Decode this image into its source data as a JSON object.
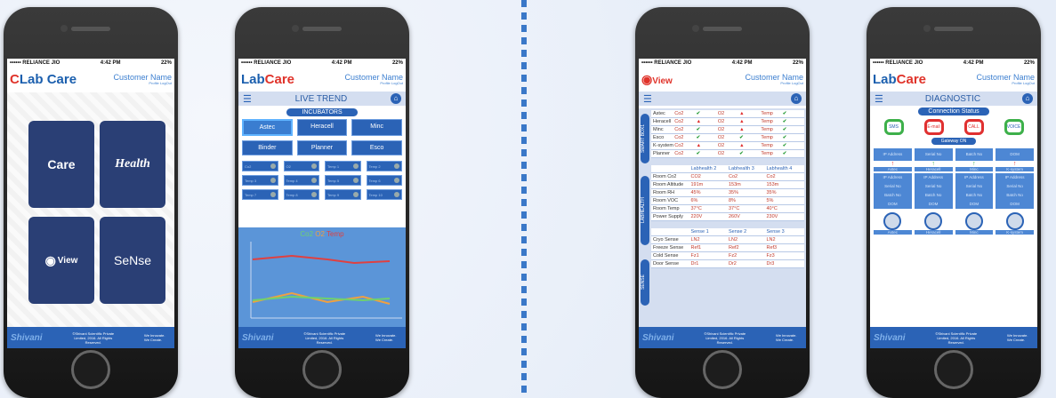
{
  "status": {
    "carrier": "•••••• RELIANCE JIO",
    "time": "4:42 PM",
    "battery": "22%"
  },
  "header": {
    "customer": "Customer Name",
    "links": "Profile LogOut"
  },
  "footer": {
    "brand": "Shivani",
    "copyright": "©Shivani Scientific Private Limited, 2016. All Rights Reserved.",
    "tagline": "We Innovate. We Create."
  },
  "p1": {
    "logo_lab": "Lab",
    "logo_care": "Care",
    "tiles": [
      "Care",
      "Health",
      "View",
      "SeNse"
    ]
  },
  "p2": {
    "logo_lab": "Lab",
    "logo_care": "Care",
    "title": "LIVE TREND",
    "section": "INCUBATORS",
    "buttons": [
      "Astec",
      "Heracell",
      "Minc",
      "Binder",
      "Planner",
      "Esco"
    ],
    "minis": [
      [
        "Co2",
        "O2",
        "Temp 1",
        "Temp 2"
      ],
      [
        "Temp 3",
        "Temp 4",
        "Temp 5",
        "Temp 6"
      ],
      [
        "Temp 7",
        "Temp 8",
        "Temp 9",
        "Temp 10"
      ]
    ],
    "legend": {
      "co2": "Co2",
      "o2": "O2",
      "temp": "Temp"
    }
  },
  "p3": {
    "logo": "View",
    "box_label": "SMART BOX1",
    "lab_label": "LABHEALTH",
    "sense_label": "SENSE",
    "box_rows": [
      "Astec",
      "Heracell",
      "Minc",
      "Esco",
      "K-system",
      "Planner"
    ],
    "box_cols": [
      "Co2",
      "O2",
      "Temp"
    ],
    "lab_head": [
      "Labhealth 2",
      "Labhealth 3",
      "Labhealth 4"
    ],
    "lab_rows": [
      [
        "Room Co2",
        "CO2",
        "Co2",
        "Co2"
      ],
      [
        "Room Altitude",
        "191m",
        "153m",
        "153m"
      ],
      [
        "Room RH",
        "45%",
        "35%",
        "35%"
      ],
      [
        "Room VOC",
        "6%",
        "8%",
        "5%"
      ],
      [
        "Room Temp",
        "37°C",
        "37°C",
        "40°C"
      ],
      [
        "Power Supply",
        "220V",
        "260V",
        "230V"
      ]
    ],
    "sense_head": [
      "Sense 1",
      "Sense 2",
      "Sense 3"
    ],
    "sense_rows": [
      [
        "Cryo Sense",
        "LN2",
        "LN2",
        "LN2"
      ],
      [
        "Freeze Sense",
        "Ref1",
        "Ref2",
        "Ref3"
      ],
      [
        "Cold Sense",
        "Fz1",
        "Fz2",
        "Fz3"
      ],
      [
        "Door Sense",
        "Dr1",
        "Dr2",
        "Dr3"
      ]
    ]
  },
  "p4": {
    "logo_lab": "Lab",
    "logo_care": "Care",
    "title": "DIAGNOSTIC",
    "conn": "Connection Status",
    "chans": [
      "SMS",
      "E-mail",
      "CALL",
      "VOICE"
    ],
    "gateway": "Gateway ON",
    "cols": [
      [
        "IP Address",
        "Astec"
      ],
      [
        "Serial No",
        "Heracell"
      ],
      [
        "Batch No",
        "Minc"
      ],
      [
        "DOM",
        "K-system"
      ]
    ],
    "list": [
      "IP Address",
      "Serial No",
      "Batch No",
      "DOM"
    ],
    "devices": [
      "Astec",
      "Heracell",
      "Minc",
      "K-system"
    ]
  }
}
